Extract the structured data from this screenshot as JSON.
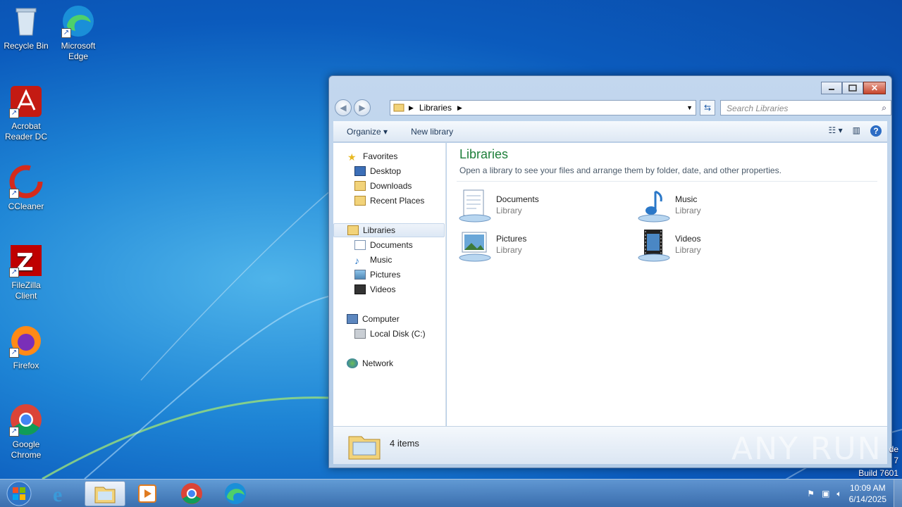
{
  "desktop": {
    "icons": [
      {
        "label": "Recycle Bin",
        "icon": "recycle-bin-icon"
      },
      {
        "label": "Microsoft Edge",
        "icon": "edge-icon"
      },
      {
        "label": "Acrobat Reader DC",
        "icon": "acrobat-icon"
      },
      {
        "label": "CCleaner",
        "icon": "ccleaner-icon"
      },
      {
        "label": "FileZilla Client",
        "icon": "filezilla-icon"
      },
      {
        "label": "Firefox",
        "icon": "firefox-icon"
      },
      {
        "label": "Google Chrome",
        "icon": "chrome-icon"
      }
    ],
    "watermark": "ANY RUN",
    "build_lines": [
      "de",
      "7",
      "Build 7601"
    ]
  },
  "explorer": {
    "address": "Libraries",
    "search_placeholder": "Search Libraries",
    "toolbar": {
      "organize": "Organize",
      "new_library": "New library"
    },
    "nav": {
      "favorites": "Favorites",
      "desktop": "Desktop",
      "downloads": "Downloads",
      "recent_places": "Recent Places",
      "libraries": "Libraries",
      "documents": "Documents",
      "music": "Music",
      "pictures": "Pictures",
      "videos": "Videos",
      "computer": "Computer",
      "local_disk": "Local Disk (C:)",
      "network": "Network"
    },
    "content": {
      "title": "Libraries",
      "subtitle": "Open a library to see your files and arrange them by folder, date, and other properties.",
      "libraries": [
        {
          "name": "Documents",
          "type": "Library"
        },
        {
          "name": "Music",
          "type": "Library"
        },
        {
          "name": "Pictures",
          "type": "Library"
        },
        {
          "name": "Videos",
          "type": "Library"
        }
      ]
    },
    "details": {
      "count": "4 items"
    }
  },
  "taskbar": {
    "clock_time": "10:09 AM",
    "clock_date": "6/14/2025"
  }
}
